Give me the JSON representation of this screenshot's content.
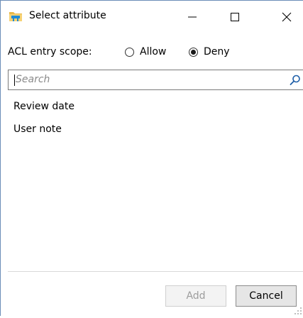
{
  "window": {
    "title": "Select attribute"
  },
  "scope": {
    "label": "ACL entry scope:",
    "options": [
      {
        "label": "Allow",
        "selected": false
      },
      {
        "label": "Deny",
        "selected": true
      }
    ]
  },
  "search": {
    "value": "",
    "placeholder": "Search",
    "icon": "search-icon"
  },
  "attributes": {
    "items": [
      {
        "label": "Review date"
      },
      {
        "label": "User note"
      }
    ]
  },
  "buttons": {
    "add_label": "Add",
    "add_enabled": false,
    "cancel_label": "Cancel"
  },
  "colors": {
    "accent": "#0067c0",
    "disabled_text": "#9d9d9d"
  }
}
